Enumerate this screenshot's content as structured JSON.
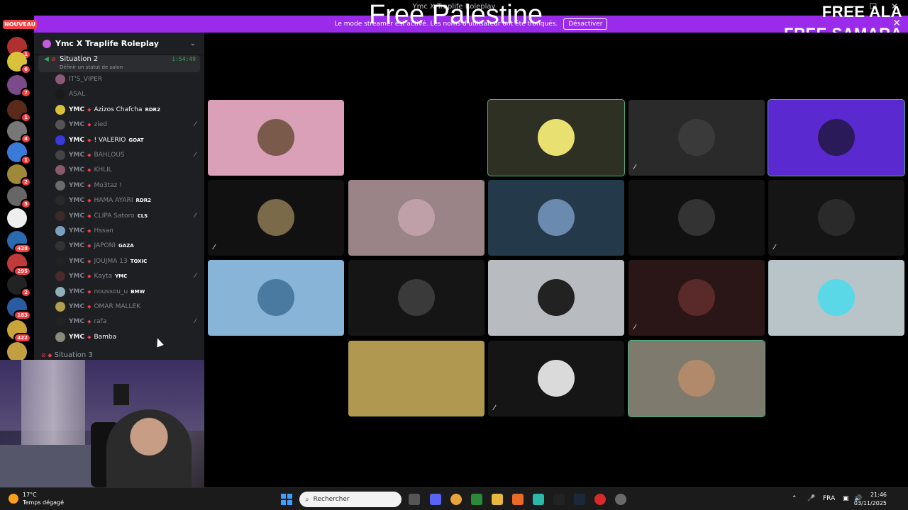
{
  "window": {
    "title": "Ymc X Traplife Roleplay"
  },
  "overlay": {
    "center": "Free Palestine",
    "right_line1": "FREE ALA",
    "right_line2": "FREE SAMARA"
  },
  "streamer_bar": {
    "message": "Le mode streamer est activé. Les noms d'utilisateur ont été tronqués.",
    "button": "Désactiver"
  },
  "rail": {
    "new_label": "NOUVEAU",
    "servers": [
      {
        "badge": "1",
        "color": "#b03030"
      },
      {
        "badge": "6",
        "color": "#d8c23a"
      },
      {
        "badge": "7",
        "color": "#7a4a8a"
      },
      {
        "badge": "1",
        "color": "#5a2a1a"
      },
      {
        "badge": "4",
        "color": "#777777"
      },
      {
        "badge": "1",
        "color": "#3a7ad8"
      },
      {
        "badge": "2",
        "color": "#a0883a"
      },
      {
        "badge": "5",
        "color": "#666666"
      },
      {
        "badge": "",
        "color": "#eeeeee"
      },
      {
        "badge": "428",
        "color": "#2a6ab0"
      },
      {
        "badge": "295",
        "color": "#c03a3a"
      },
      {
        "badge": "2",
        "color": "#222222"
      },
      {
        "badge": "183",
        "color": "#2a5aa0"
      },
      {
        "badge": "422",
        "color": "#c9a43a"
      },
      {
        "badge": "",
        "color": "#c0a040"
      }
    ]
  },
  "sidebar": {
    "server_name": "Ymc X Traplife Roleplay",
    "voice_channel": {
      "name": "Situation 2",
      "time": "1:54:49",
      "status": "Définir un statut de salon"
    },
    "members": [
      {
        "tag": "",
        "name": "IT'S_VIPER",
        "role": "",
        "style": "dim",
        "color": "#8b5a7a",
        "muted": false
      },
      {
        "tag": "",
        "name": "ASAL",
        "role": "",
        "style": "dim",
        "color": "#1a1a1a",
        "muted": false
      },
      {
        "tag": "YMC",
        "name": "Azizos Chafcha",
        "role": "RDR2",
        "style": "bright",
        "color": "#d8c23a",
        "muted": false
      },
      {
        "tag": "YMC",
        "name": "zied",
        "role": "",
        "style": "dim",
        "color": "#555555",
        "muted": true
      },
      {
        "tag": "YMC",
        "name": "! VALERIO",
        "role": "GOAT",
        "style": "bright",
        "color": "#3a3ad8",
        "muted": false
      },
      {
        "tag": "YMC",
        "name": "BAHLOUS",
        "role": "",
        "style": "dim",
        "color": "#444444",
        "muted": true
      },
      {
        "tag": "YMC",
        "name": "KHLIL",
        "role": "",
        "style": "dim",
        "color": "#8a5a6a",
        "muted": false
      },
      {
        "tag": "YMC",
        "name": "Mo3taz !",
        "role": "",
        "style": "dim",
        "color": "#6a6a6a",
        "muted": false
      },
      {
        "tag": "YMC",
        "name": "HAMA AYARI",
        "role": "RDR2",
        "style": "dim",
        "color": "#2a2a2a",
        "muted": false
      },
      {
        "tag": "YMC",
        "name": "CLIPA Satoro",
        "role": "CLS",
        "style": "dim",
        "color": "#3a2a2a",
        "muted": true
      },
      {
        "tag": "YMC",
        "name": "Hssan",
        "role": "",
        "style": "dim",
        "color": "#7aa0c0",
        "muted": false
      },
      {
        "tag": "YMC",
        "name": "JAPONI",
        "role": "GAZA",
        "style": "dim",
        "color": "#333333",
        "muted": false
      },
      {
        "tag": "YMC",
        "name": "JOUJMA 13",
        "role": "TOXIC",
        "style": "dim",
        "color": "#222222",
        "muted": false
      },
      {
        "tag": "YMC",
        "name": "Kayta",
        "role": "YMC",
        "style": "dim",
        "color": "#4a2a2a",
        "muted": true
      },
      {
        "tag": "YMC",
        "name": "noussou_u",
        "role": "BMW",
        "style": "dim",
        "color": "#8fb0b8",
        "muted": false
      },
      {
        "tag": "YMC",
        "name": "OMAR MALLEK",
        "role": "",
        "style": "dim",
        "color": "#b0a050",
        "muted": false
      },
      {
        "tag": "YMC",
        "name": "rafa",
        "role": "",
        "style": "dim",
        "color": "#222222",
        "muted": true
      },
      {
        "tag": "YMC",
        "name": "Bamba",
        "role": "",
        "style": "bright",
        "color": "#8a8a7a",
        "muted": false
      }
    ],
    "next_channel": "Situation 3"
  },
  "tiles": [
    {
      "bg": "#d9a0b8",
      "avatar": "#7a5a4a",
      "speaking": false,
      "muted": false
    },
    {
      "bg": "#000000",
      "avatar": "#000000",
      "speaking": false,
      "muted": false
    },
    {
      "bg": "#2f3024",
      "avatar": "#e8e070",
      "speaking": true,
      "muted": false
    },
    {
      "bg": "#2a2a2a",
      "avatar": "#3a3a3a",
      "speaking": false,
      "muted": true
    },
    {
      "bg": "#5a2ad0",
      "avatar": "#2a1a5a",
      "speaking": true,
      "muted": false
    },
    {
      "bg": "#111111",
      "avatar": "#7a6a4a",
      "speaking": false,
      "muted": true
    },
    {
      "bg": "#9a8488",
      "avatar": "#c0a0a8",
      "speaking": false,
      "muted": false
    },
    {
      "bg": "#24394a",
      "avatar": "#6a8ab0",
      "speaking": false,
      "muted": false
    },
    {
      "bg": "#111111",
      "avatar": "#333333",
      "speaking": false,
      "muted": false
    },
    {
      "bg": "#151515",
      "avatar": "#2a2a2a",
      "speaking": false,
      "muted": true
    },
    {
      "bg": "#88b4d8",
      "avatar": "#4a7aa0",
      "speaking": false,
      "muted": false
    },
    {
      "bg": "#151515",
      "avatar": "#3a3a3a",
      "speaking": false,
      "muted": false
    },
    {
      "bg": "#b8bcc0",
      "avatar": "#222222",
      "speaking": false,
      "muted": false
    },
    {
      "bg": "#2a1616",
      "avatar": "#5a2a2a",
      "speaking": false,
      "muted": true
    },
    {
      "bg": "#b8c4c8",
      "avatar": "#5ad8e8",
      "speaking": false,
      "muted": false
    },
    {
      "bg": "#b09850",
      "avatar": "#b09850",
      "speaking": false,
      "muted": false
    },
    {
      "bg": "#151515",
      "avatar": "#dadada",
      "speaking": false,
      "muted": true
    },
    {
      "bg": "#7e7a6e",
      "avatar": "#b08a6a",
      "speaking": true,
      "muted": false
    }
  ],
  "taskbar": {
    "weather_temp": "17°C",
    "weather_desc": "Temps dégagé",
    "search_placeholder": "Rechercher",
    "lang": "FRA",
    "time": "21:46",
    "date": "03/11/2025"
  }
}
